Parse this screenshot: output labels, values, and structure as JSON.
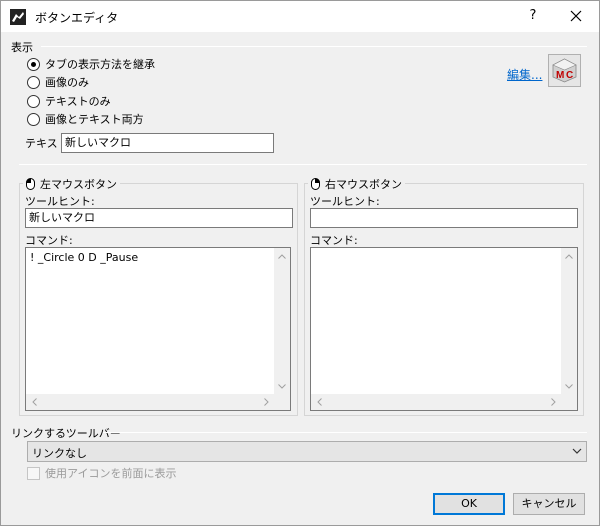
{
  "window": {
    "title": "ボタンエディタ",
    "help_label": "?",
    "close_icon": "close-icon"
  },
  "display": {
    "section_label": "表示",
    "options": [
      {
        "label": "タブの表示方法を継承",
        "checked": true
      },
      {
        "label": "画像のみ",
        "checked": false
      },
      {
        "label": "テキストのみ",
        "checked": false
      },
      {
        "label": "画像とテキスト両方",
        "checked": false
      }
    ],
    "edit_link": "編集...",
    "text_label": "テキスト:",
    "text_value": "新しいマクロ"
  },
  "left_button": {
    "title": "左マウスボタン",
    "tooltip_label": "ツールヒント:",
    "tooltip_value": "新しいマクロ",
    "command_label": "コマンド:",
    "command_value": "! _Circle 0 D _Pause"
  },
  "right_button": {
    "title": "右マウスボタン",
    "tooltip_label": "ツールヒント:",
    "tooltip_value": "",
    "command_label": "コマンド:",
    "command_value": ""
  },
  "linked_toolbar": {
    "section_label": "リンクするツールバー",
    "selected": "リンクなし",
    "checkbox_label": "使用アイコンを前面に表示",
    "checkbox_checked": false
  },
  "footer": {
    "ok_label": "OK",
    "cancel_label": "キャンセル"
  },
  "colors": {
    "accent": "#0078d7",
    "link": "#0066cc",
    "window_bg": "#f0f0f0"
  }
}
